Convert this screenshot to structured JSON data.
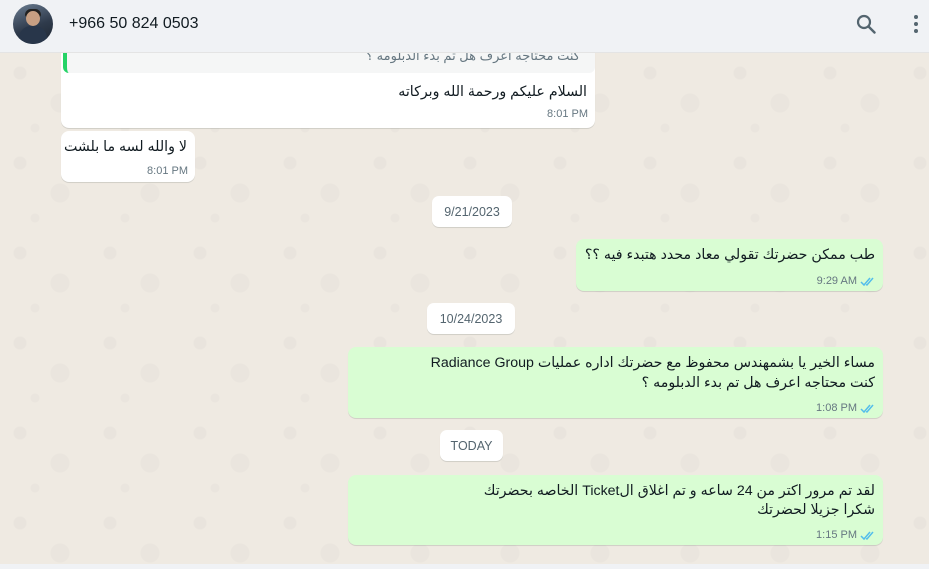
{
  "header": {
    "contact_name": "+966 50 824 0503",
    "avatar_icon": "person-photo-avatar",
    "search_icon": "search-icon",
    "menu_icon": "more-vertical-icon"
  },
  "colors": {
    "incoming_bubble": "#ffffff",
    "outgoing_bubble": "#d9fdd3",
    "quote_accent": "#25d366",
    "read_ticks": "#53bdeb",
    "chat_background": "#efeae2"
  },
  "messages": [
    {
      "direction": "incoming",
      "quoted_text": "كنت محتاجه اعرف هل تم بدء الدبلومه ؟",
      "text": "السلام عليكم ورحمة الله وبركاته",
      "time": "8:01 PM"
    },
    {
      "direction": "incoming",
      "text": "لا والله لسه ما بلشت",
      "time": "8:01 PM"
    },
    {
      "type": "date",
      "label": "9/21/2023"
    },
    {
      "direction": "outgoing",
      "text": "طب ممكن حضرتك تقولي معاد محدد هتبدء فيه ؟؟",
      "time": "9:29 AM",
      "status": "read"
    },
    {
      "type": "date",
      "label": "10/24/2023"
    },
    {
      "direction": "outgoing",
      "line1": "مساء الخير يا بشمهندس محفوظ مع حضرتك اداره عمليات Radiance Group",
      "line2": "كنت محتاجه اعرف هل تم بدء الدبلومه ؟",
      "time": "1:08 PM",
      "status": "read"
    },
    {
      "type": "date",
      "label": "TODAY"
    },
    {
      "direction": "outgoing",
      "line1": "لقد تم مرور اكتر من 24 ساعه و تم اغلاق الTicket الخاصه بحضرتك",
      "line2": "شكرا جزيلا لحضرتك",
      "time": "1:15 PM",
      "status": "read"
    }
  ]
}
